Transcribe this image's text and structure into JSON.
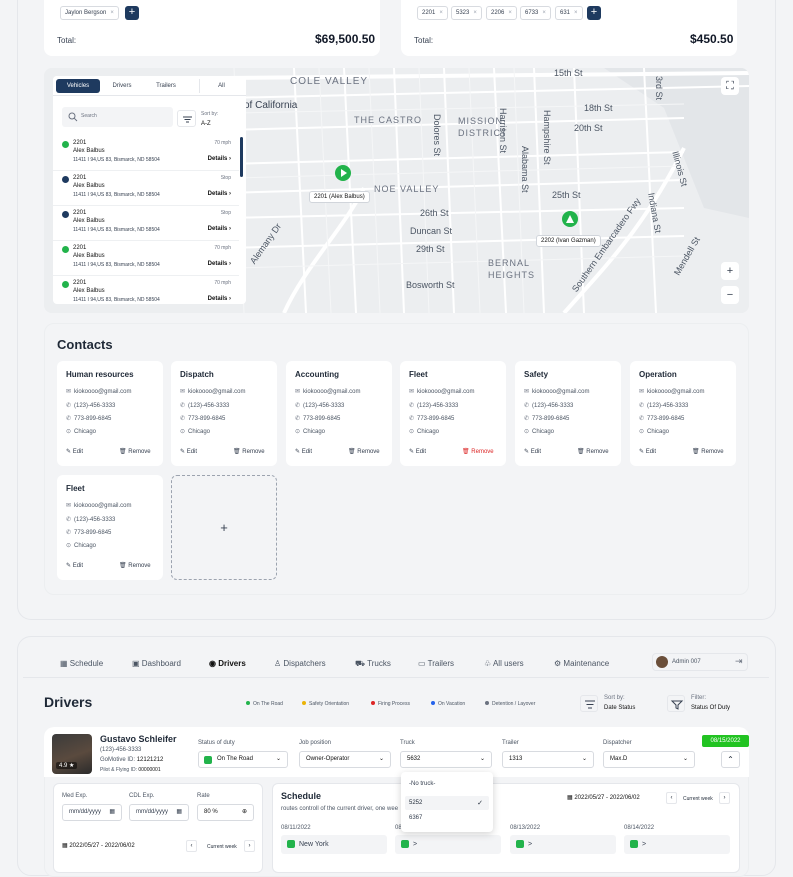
{
  "top": {
    "left_chips": [
      "Jaylon Bergson"
    ],
    "left_total_label": "Total:",
    "left_total_value": "$69,500.50",
    "right_chips": [
      "2201",
      "5323",
      "2206",
      "6733",
      "631"
    ],
    "right_total_label": "Total:",
    "right_total_value": "$450.50",
    "chip_x": "×",
    "add": "+"
  },
  "map": {
    "neighborhoods": [
      "COLE VALLEY",
      "of California",
      "THE CASTRO",
      "MISSION",
      "DISTRICT",
      "NOE VALLEY",
      "BERNAL",
      "HEIGHTS"
    ],
    "streets": [
      "15th St",
      "18th St",
      "20th St",
      "25th St",
      "26th St",
      "Duncan St",
      "29th St",
      "Harrison St",
      "Dolores St",
      "Alabama St",
      "Hampshire St",
      "3rd St",
      "Illinois St",
      "Indiana St",
      "Mendell St",
      "Southern Embarcadero Fwy",
      "Bosworth St",
      "Alemany Dr"
    ],
    "markers": [
      {
        "label": "2201 (Alex Balbus)"
      },
      {
        "label": "2202 (Ivan Gazman)"
      }
    ],
    "zoom_in": "+",
    "zoom_out": "−",
    "fullscreen": "⛶"
  },
  "panel": {
    "tabs": [
      "Vehicles",
      "Drivers",
      "Trailers",
      "All"
    ],
    "search_placeholder": "Search",
    "sort_label": "Sort by:",
    "sort_value": "A-Z",
    "vehicles": [
      {
        "num": "2201",
        "name": "Alex Balbus",
        "addr": "11411 I 94,US 83, Bismarck, ND 58504",
        "speed": "70 mph",
        "details": "Details ›",
        "status": "moving"
      },
      {
        "num": "2201",
        "name": "Alex Balbus",
        "addr": "11411 I 94,US 83, Bismarck, ND 58504",
        "speed": "Stop",
        "details": "Details ›",
        "status": "stop"
      },
      {
        "num": "2201",
        "name": "Alex Balbus",
        "addr": "11411 I 94,US 83, Bismarck, ND 58504",
        "speed": "Stop",
        "details": "Details ›",
        "status": "stop"
      },
      {
        "num": "2201",
        "name": "Alex Balbus",
        "addr": "11411 I 94,US 83, Bismarck, ND 58504",
        "speed": "70 mph",
        "details": "Details ›",
        "status": "moving"
      },
      {
        "num": "2201",
        "name": "Alex Balbus",
        "addr": "11411 I 94,US 83, Bismarck, ND 58504",
        "speed": "70 mph",
        "details": "Details ›",
        "status": "moving"
      }
    ]
  },
  "contacts": {
    "title": "Contacts",
    "cards": [
      {
        "title": "Human resources",
        "email": "kiokoooo@gmail.com",
        "phone1": "(123)-456-3333",
        "phone2": "773-899-6845",
        "city": "Chicago",
        "edit": "Edit",
        "remove": "Remove"
      },
      {
        "title": "Dispatch",
        "email": "kiokoooo@gmail.com",
        "phone1": "(123)-456-3333",
        "phone2": "773-899-6845",
        "city": "Chicago",
        "edit": "Edit",
        "remove": "Remove"
      },
      {
        "title": "Accounting",
        "email": "kiokoooo@gmail.com",
        "phone1": "(123)-456-3333",
        "phone2": "773-899-6845",
        "city": "Chicago",
        "edit": "Edit",
        "remove": "Remove"
      },
      {
        "title": "Fleet",
        "email": "kiokoooo@gmail.com",
        "phone1": "(123)-456-3333",
        "phone2": "773-899-6845",
        "city": "Chicago",
        "edit": "Edit",
        "remove": "Remove"
      },
      {
        "title": "Safety",
        "email": "kiokoooo@gmail.com",
        "phone1": "(123)-456-3333",
        "phone2": "773-899-6845",
        "city": "Chicago",
        "edit": "Edit",
        "remove": "Remove"
      },
      {
        "title": "Operation",
        "email": "kiokoooo@gmail.com",
        "phone1": "(123)-456-3333",
        "phone2": "773-899-6845",
        "city": "Chicago",
        "edit": "Edit",
        "remove": "Remove"
      },
      {
        "title": "Fleet",
        "email": "kiokoooo@gmail.com",
        "phone1": "(123)-456-3333",
        "phone2": "773-899-6845",
        "city": "Chicago",
        "edit": "Edit",
        "remove": "Remove"
      }
    ],
    "add": "+"
  },
  "nav": {
    "items": [
      "Schedule",
      "Dashboard",
      "Drivers",
      "Dispatchers",
      "Trucks",
      "Trailers",
      "All users",
      "Maintenance"
    ],
    "user": "Admin 007"
  },
  "drivers": {
    "title": "Drivers",
    "legend": [
      "On The Road",
      "Safety Orientation",
      "Firing Process",
      "On Vacation",
      "Detention / Layover"
    ],
    "legend_colors": [
      "#22b34b",
      "#eab308",
      "#dc2626",
      "#2563eb",
      "#6b7280"
    ],
    "sort_label": "Sort by:",
    "sort_value": "Date Status",
    "filter_label": "Filter:",
    "filter_value": "Status Of Duty",
    "driver": {
      "name": "Gustavo Schleifer",
      "phone": "(123)-456-3333",
      "gomotive_label": "GoMotive ID:",
      "gomotive": "12121212",
      "pilot_label": "Pilot & Flying ID:",
      "pilot": "00000001",
      "rating": "4.9 ★",
      "date_badge": "08/15/2022"
    },
    "fields": {
      "status_label": "Status of duty",
      "status_value": "On The Road",
      "position_label": "Job position",
      "position_value": "Owner-Operator",
      "truck_label": "Truck",
      "truck_value": "5632",
      "trailer_label": "Trailer",
      "trailer_value": "1313",
      "dispatcher_label": "Dispatcher",
      "dispatcher_value": "Max.D"
    },
    "truck_options": [
      "-No truck-",
      "5252",
      "6367"
    ],
    "selected_check": "✓",
    "med_label": "Med Exp.",
    "med_placeholder": "mm/dd/yyyy",
    "cdl_label": "CDL Exp.",
    "cdl_placeholder": "mm/dd/yyyy",
    "rate_label": "Rate",
    "rate_value": "80 %",
    "small_range": "2022/05/27 - 2022/06/02",
    "current_week": "Current week",
    "schedule": {
      "title": "Schedule",
      "subtitle": "routes controll of the current driver, one wee",
      "range": "2022/05/27 - 2022/06/02",
      "days": [
        "08/11/2022",
        "08/",
        "08/13/2022",
        "08/14/2022"
      ],
      "cells": [
        "New York",
        ">",
        ">",
        ">"
      ]
    }
  }
}
